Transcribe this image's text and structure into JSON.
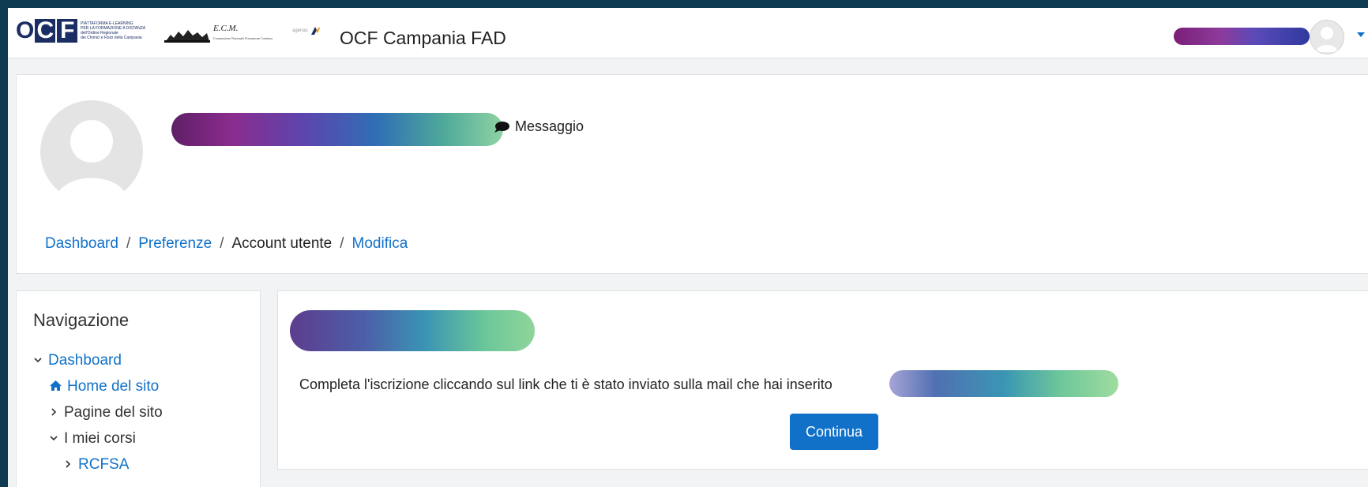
{
  "navbar": {
    "logo_letters": [
      "O",
      "C",
      "F"
    ],
    "logo_tagline_lines": [
      "PIATTAFORMA E-LEARNING",
      "PER LA FORMAZIONE A DISTANZA",
      "dell'Ordine Regionale",
      "dei Chimici e Fisici della Campania"
    ],
    "ecm_title": "E.C.M.",
    "ecm_subtitle": "Commissione Nazionale Formazione Continua",
    "agenas_text": "agenas",
    "site_title": "OCF Campania FAD"
  },
  "profile": {
    "message_label": "Messaggio"
  },
  "breadcrumb": {
    "items": [
      {
        "label": "Dashboard",
        "link": true
      },
      {
        "label": "Preferenze",
        "link": true
      },
      {
        "label": "Account utente",
        "link": false
      },
      {
        "label": "Modifica",
        "link": true
      }
    ],
    "separator": "/"
  },
  "navigation": {
    "title": "Navigazione",
    "items": [
      {
        "label": "Dashboard",
        "chevron": "chevron-down",
        "link": true
      },
      {
        "label": "Home del sito",
        "icon": "home-icon",
        "link": true
      },
      {
        "label": "Pagine del sito",
        "chevron": "chevron-right",
        "link": false
      },
      {
        "label": "I miei corsi",
        "chevron": "chevron-down",
        "link": false
      },
      {
        "label": "RCFSA",
        "chevron": "chevron-right",
        "link": true
      }
    ]
  },
  "main": {
    "notice": "Completa l'iscrizione cliccando sul link che ti è stato inviato sulla mail che hai inserito",
    "continue_label": "Continua"
  },
  "colors": {
    "accent": "#1171c8",
    "outer_background": "#0f3b52",
    "page_background": "#f1f3f4",
    "logo_navy": "#1a2e64"
  }
}
